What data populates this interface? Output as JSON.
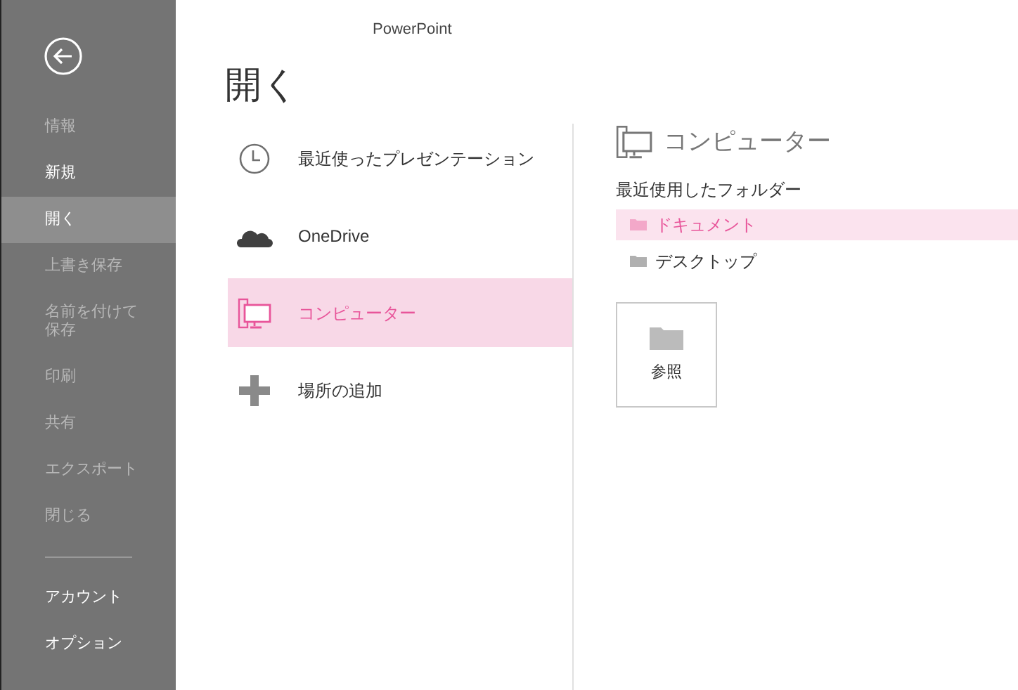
{
  "window": {
    "title": "PowerPoint"
  },
  "sidebar": {
    "items": [
      {
        "label": "情報",
        "disabled": true,
        "selected": false
      },
      {
        "label": "新規",
        "disabled": false,
        "selected": false
      },
      {
        "label": "開く",
        "disabled": false,
        "selected": true
      },
      {
        "label": "上書き保存",
        "disabled": true,
        "selected": false
      },
      {
        "label": "名前を付けて保存",
        "disabled": true,
        "selected": false
      },
      {
        "label": "印刷",
        "disabled": true,
        "selected": false
      },
      {
        "label": "共有",
        "disabled": true,
        "selected": false
      },
      {
        "label": "エクスポート",
        "disabled": true,
        "selected": false
      },
      {
        "label": "閉じる",
        "disabled": true,
        "selected": false
      }
    ],
    "bottom_items": [
      {
        "label": "アカウント",
        "disabled": false,
        "selected": false
      },
      {
        "label": "オプション",
        "disabled": false,
        "selected": false
      }
    ]
  },
  "heading": "開く",
  "places": [
    {
      "kind": "clock",
      "label": "最近使ったプレゼンテーション",
      "selected": false
    },
    {
      "kind": "cloud",
      "label": "OneDrive",
      "selected": false
    },
    {
      "kind": "computer",
      "label": "コンピューター",
      "selected": true
    },
    {
      "kind": "plus",
      "label": "場所の追加",
      "selected": false
    }
  ],
  "detail": {
    "title": "コンピューター",
    "section": "最近使用したフォルダー",
    "folders": [
      {
        "label": "ドキュメント",
        "selected": true
      },
      {
        "label": "デスクトップ",
        "selected": false
      }
    ],
    "browse": "参照"
  }
}
